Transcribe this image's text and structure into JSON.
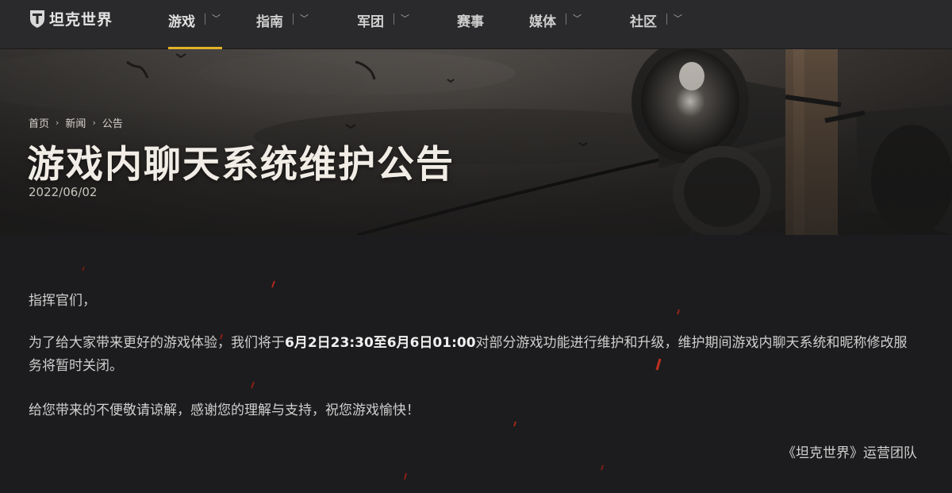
{
  "brand": {
    "name": "坦克世界",
    "logo_icon": "tank-shield-logo"
  },
  "nav": {
    "items": [
      {
        "label": "游戏",
        "has_dropdown": true,
        "active": true
      },
      {
        "label": "指南",
        "has_dropdown": true,
        "active": false
      },
      {
        "label": "军团",
        "has_dropdown": true,
        "active": false
      },
      {
        "label": "赛事",
        "has_dropdown": false,
        "active": false
      },
      {
        "label": "媒体",
        "has_dropdown": true,
        "active": false
      },
      {
        "label": "社区",
        "has_dropdown": true,
        "active": false
      }
    ],
    "accent_color": "#e1b128"
  },
  "breadcrumb": [
    "首页",
    "新闻",
    "公告"
  ],
  "article": {
    "title": "游戏内聊天系统维护公告",
    "date": "2022/06/02",
    "greeting": "指挥官们，",
    "main_prefix": "为了给大家带来更好的游戏体验，我们将于",
    "main_bold": "6月2日23:30至6月6日01:00",
    "main_suffix": "对部分游戏功能进行维护和升级，维护期间游戏内聊天系统和昵称修改服务将暂时关闭。",
    "thanks": "给您带来的不便敬请谅解，感谢您的理解与支持，祝您游戏愉快！",
    "signature": "《坦克世界》运营团队"
  }
}
